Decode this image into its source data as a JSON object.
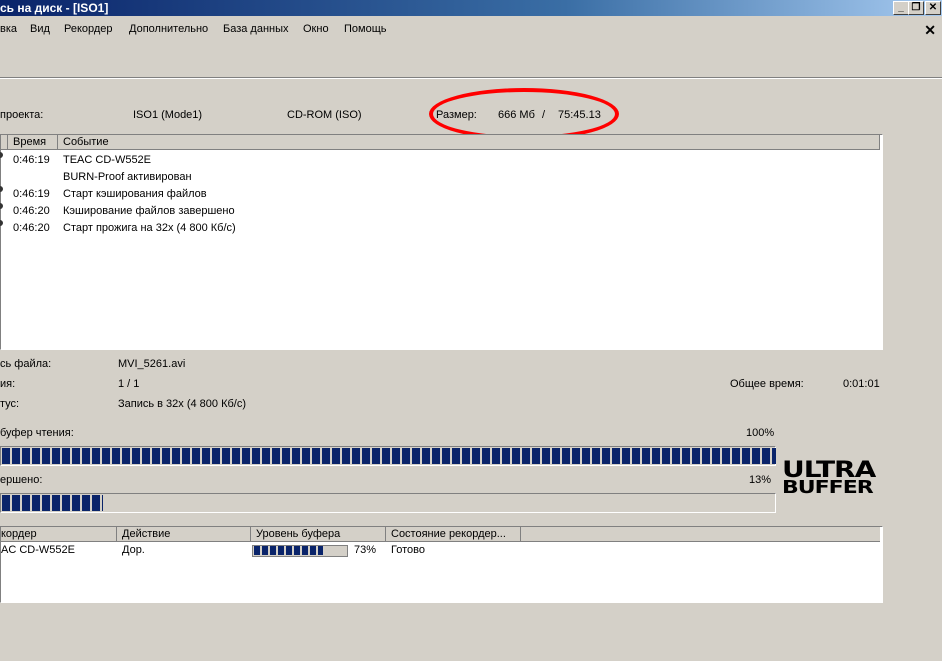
{
  "window": {
    "title": "сь на диск - [ISO1]"
  },
  "menu": [
    {
      "label": "вка"
    },
    {
      "label": "Вид"
    },
    {
      "label": "Рекордер"
    },
    {
      "label": "Дополнительно"
    },
    {
      "label": "База данных"
    },
    {
      "label": "Окно"
    },
    {
      "label": "Помощь"
    }
  ],
  "project": {
    "label": "проекта:",
    "name": "ISO1 (Mode1)",
    "type": "CD-ROM (ISO)",
    "size_label": "Размер:",
    "size_value": "666 Мб",
    "separator": "/",
    "duration": "75:45.13"
  },
  "log": {
    "columns": [
      "Время",
      "Событие"
    ],
    "rows": [
      {
        "time": "0:46:19",
        "event": "TEAC CD-W552E",
        "bullet": true
      },
      {
        "time": "",
        "event": "BURN-Proof активирован",
        "bullet": false
      },
      {
        "time": "0:46:19",
        "event": "Старт кэширования файлов",
        "bullet": true
      },
      {
        "time": "0:46:20",
        "event": "Кэширование файлов завершено",
        "bullet": true
      },
      {
        "time": "0:46:20",
        "event": "Старт прожига на 32x (4 800 Кб/с)",
        "bullet": true
      }
    ]
  },
  "status": {
    "file_label": "сь файла:",
    "file_value": "MVI_5261.avi",
    "copy_label": "ия:",
    "copy_value": "1 / 1",
    "total_time_label": "Общее время:",
    "total_time_value": "0:01:01",
    "state_label": "тус:",
    "state_value": "Запись в 32x (4 800 Кб/с)"
  },
  "progress": {
    "buffer_label": "буфер чтения:",
    "buffer_percent_text": "100%",
    "buffer_fraction": 1.0,
    "done_label": "ершено:",
    "done_percent_text": "13%",
    "done_fraction": 0.13
  },
  "logo": {
    "line1": "ULTRA",
    "line2": "BUFFER"
  },
  "recorders": {
    "columns": [
      "кордер",
      "Действие",
      "Уровень буфера",
      "Состояние рекордер..."
    ],
    "rows": [
      {
        "recorder": "AC CD-W552E",
        "action": "Дор.",
        "buffer_fraction": 0.73,
        "buffer_text": "73%",
        "state": "Готово"
      }
    ]
  },
  "colors": {
    "bar_fill": "#0a246a",
    "annotation": "#ff0000",
    "face": "#d4d0c8"
  }
}
